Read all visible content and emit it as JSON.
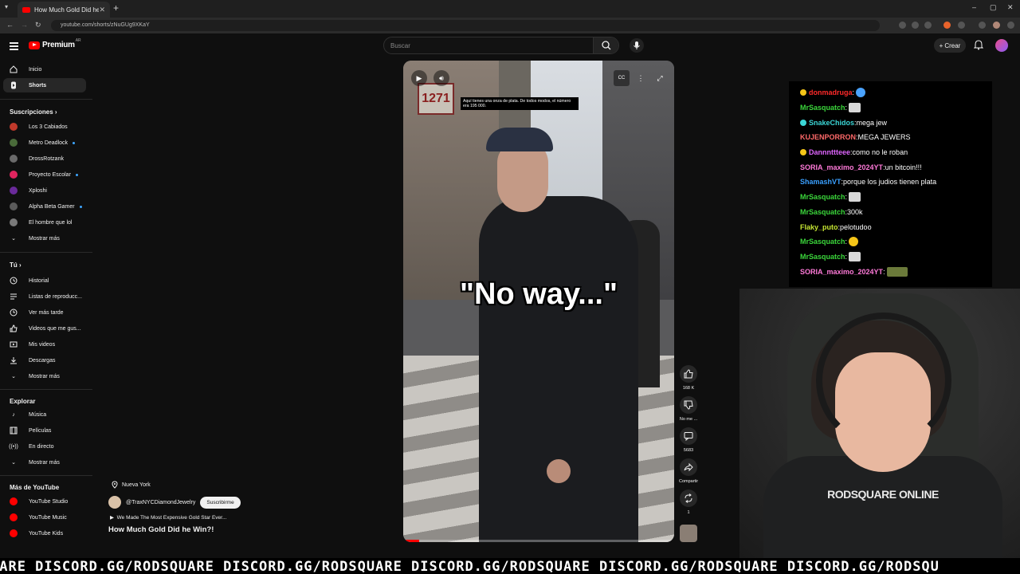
{
  "browser": {
    "tab_title": "How Much Gold Did he Win?!",
    "url": "youtube.com/shorts/zNuGUg9XKaY"
  },
  "header": {
    "logo_text": "Premium",
    "logo_superscript": "AR",
    "search_placeholder": "Buscar",
    "create_label": "Crear"
  },
  "sidebar": {
    "main": [
      {
        "label": "Inicio",
        "icon": "home-icon"
      },
      {
        "label": "Shorts",
        "icon": "shorts-icon",
        "active": true
      }
    ],
    "subscriptions_title": "Suscripciones",
    "subscriptions": [
      {
        "label": "Los 3 Cabiados",
        "color": "#c0392b",
        "dot": false
      },
      {
        "label": "Metro Deadlock",
        "color": "#4a6b3a",
        "dot": true
      },
      {
        "label": "DrossRotzank",
        "color": "#6a6a6a",
        "dot": false
      },
      {
        "label": "Proyecto Escolar",
        "color": "#e0245e",
        "dot": true
      },
      {
        "label": "Xploshi",
        "color": "#6a2a9a",
        "dot": false
      },
      {
        "label": "Alpha Beta Gamer",
        "color": "#5a5a5a",
        "dot": true
      },
      {
        "label": "El hombre que lol",
        "color": "#7a7a7a",
        "dot": false
      }
    ],
    "subs_more": "Mostrar más",
    "you_title": "Tú",
    "you": [
      {
        "label": "Historial",
        "icon": "history-icon"
      },
      {
        "label": "Listas de reproducc...",
        "icon": "playlist-icon"
      },
      {
        "label": "Ver más tarde",
        "icon": "clock-icon"
      },
      {
        "label": "Videos que me gus...",
        "icon": "thumbs-up-icon"
      },
      {
        "label": "Mis videos",
        "icon": "video-icon"
      },
      {
        "label": "Descargas",
        "icon": "download-icon"
      }
    ],
    "you_more": "Mostrar más",
    "explore_title": "Explorar",
    "explore": [
      {
        "label": "Música",
        "icon": "music-note-icon"
      },
      {
        "label": "Películas",
        "icon": "film-icon"
      },
      {
        "label": "En directo",
        "icon": "live-icon"
      }
    ],
    "explore_more": "Mostrar más",
    "more_title": "Más de YouTube",
    "more": [
      {
        "label": "YouTube Studio",
        "color": "#ff0000"
      },
      {
        "label": "YouTube Music",
        "color": "#ff0000"
      },
      {
        "label": "YouTube Kids",
        "color": "#ff0000"
      }
    ]
  },
  "player": {
    "caption": "Aquí tienes una onza de plata. De todos modos, el número era 195 000.",
    "overlay_text": "\"No way...\"",
    "sign_text": "1271",
    "progress": 0.06
  },
  "actions": {
    "likes": "168 K",
    "dislike_label": "No me ...",
    "comments": "5683",
    "share_label": "Compartir",
    "remix_count": "1"
  },
  "short_info": {
    "location": "Nueva York",
    "channel": "@TraxNYCDiamondJewelry",
    "subscribe_label": "Suscribirme",
    "music": "We Made The Most Expensive Gold Star Ever...",
    "title": "How Much Gold Did he Win?!"
  },
  "chat": [
    {
      "user": "donmadruga",
      "color": "#ff2a2a",
      "text": "",
      "emote": "blue",
      "badge": "#f5c518"
    },
    {
      "user": "MrSasquatch",
      "color": "#3bd63b",
      "text": "",
      "emote": "img"
    },
    {
      "user": "SnakeChidos",
      "color": "#3bd6d6",
      "text": " mega jew",
      "emote": "",
      "badge": "#3bd6d6"
    },
    {
      "user": "KUJENPORRON",
      "color": "#ff6a6a",
      "text": " MEGA JEWERS",
      "emote": ""
    },
    {
      "user": "Dannnttteee",
      "color": "#e066ff",
      "text": " como no le roban",
      "emote": "",
      "badge": "#f5c518"
    },
    {
      "user": "SORIA_maximo_2024YT",
      "color": "#ff7ad9",
      "text": " un bitcoin!!!",
      "emote": ""
    },
    {
      "user": "ShamashVT",
      "color": "#3aa0ff",
      "text": " porque los judios tienen plata",
      "emote": ""
    },
    {
      "user": "MrSasquatch",
      "color": "#3bd63b",
      "text": "",
      "emote": "img"
    },
    {
      "user": "MrSasquatch",
      "color": "#3bd63b",
      "text": " 300k",
      "emote": ""
    },
    {
      "user": "Flaky_puto",
      "color": "#c6e633",
      "text": " pelotudoo",
      "emote": ""
    },
    {
      "user": "MrSasquatch",
      "color": "#3bd63b",
      "text": "",
      "emote": "yellow"
    },
    {
      "user": "MrSasquatch",
      "color": "#3bd63b",
      "text": "",
      "emote": "img"
    },
    {
      "user": "SORIA_maximo_2024YT",
      "color": "#ff7ad9",
      "text": "",
      "emote": "green"
    }
  ],
  "webcam": {
    "shirt_text": "RODSQUARE ONLINE"
  },
  "ticker": {
    "text": "UARE DISCORD.GG/RODSQUARE DISCORD.GG/RODSQUARE DISCORD.GG/RODSQUARE DISCORD.GG/RODSQUARE DISCORD.GG/RODSQU"
  }
}
